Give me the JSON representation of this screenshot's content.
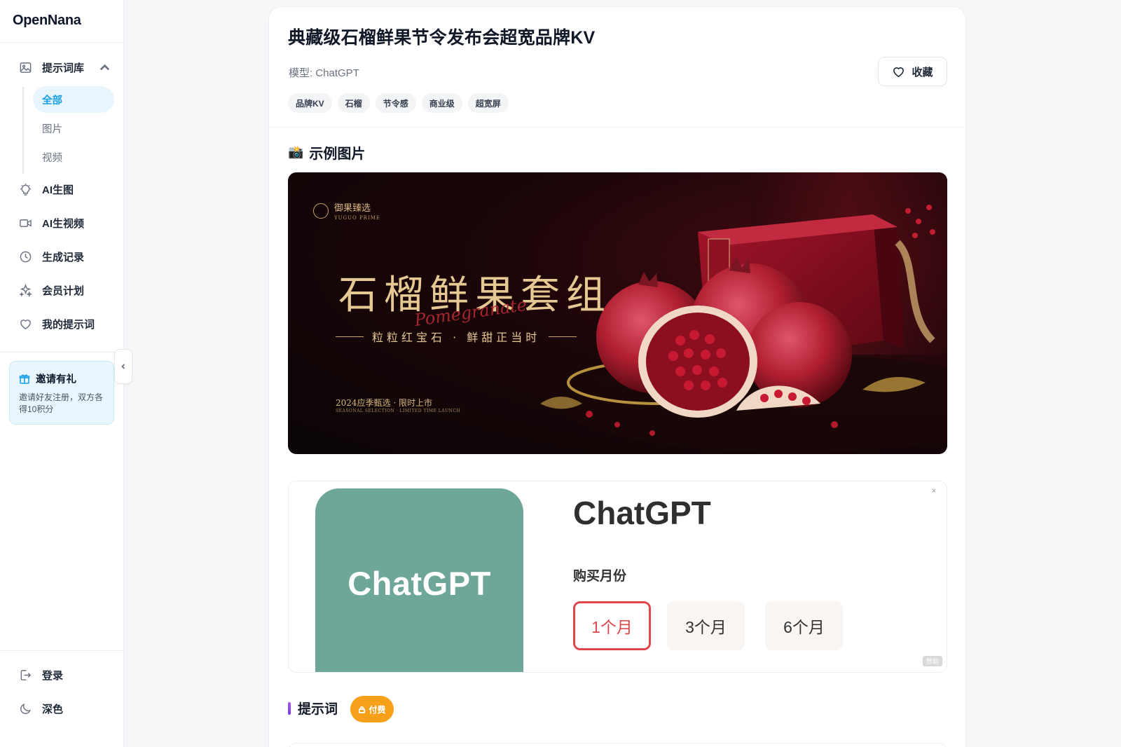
{
  "app": {
    "logo": "OpenNana"
  },
  "sidebar": {
    "library": {
      "label": "提示词库"
    },
    "sub_items": [
      {
        "label": "全部"
      },
      {
        "label": "图片"
      },
      {
        "label": "视频"
      }
    ],
    "items": [
      {
        "label": "AI生图"
      },
      {
        "label": "AI生视频"
      },
      {
        "label": "生成记录"
      },
      {
        "label": "会员计划"
      },
      {
        "label": "我的提示词"
      }
    ],
    "invite": {
      "title": "邀请有礼",
      "desc": "邀请好友注册，双方各得10积分"
    },
    "bottom": [
      {
        "label": "登录"
      },
      {
        "label": "深色"
      }
    ]
  },
  "detail": {
    "title": "典藏级石榴鲜果节令发布会超宽品牌KV",
    "model": "模型: ChatGPT",
    "favorite_label": "收藏",
    "tags": [
      "品牌KV",
      "石榴",
      "节令感",
      "商业级",
      "超宽屏"
    ],
    "example_section": "示例图片",
    "example_icon": "📸",
    "prompt_section": "提示词",
    "paid_badge": "付费"
  },
  "hero_image": {
    "brand_cn": "御果臻选",
    "brand_en": "YUGUO PRIME",
    "headline": "石榴鲜果套组",
    "script": "Pomegranate",
    "tagline": "粒粒红宝石 · 鲜甜正当时",
    "date_line": "2024应季甄选 · 限时上市",
    "date_line_en": "SEASONAL SELECTION · LIMITED TIME LAUNCH"
  },
  "ad": {
    "logo_text": "ChatGPT",
    "product": "ChatGPT",
    "label": "购买月份",
    "options": [
      "1个月",
      "3个月",
      "6个月"
    ],
    "selected": "1个月",
    "badge": "赞助",
    "close": "×"
  },
  "colors": {
    "accent": "#1aa0e6",
    "paid": "#f7a01a",
    "ad_green": "#6ea79a",
    "ad_selected": "#e0474c"
  }
}
